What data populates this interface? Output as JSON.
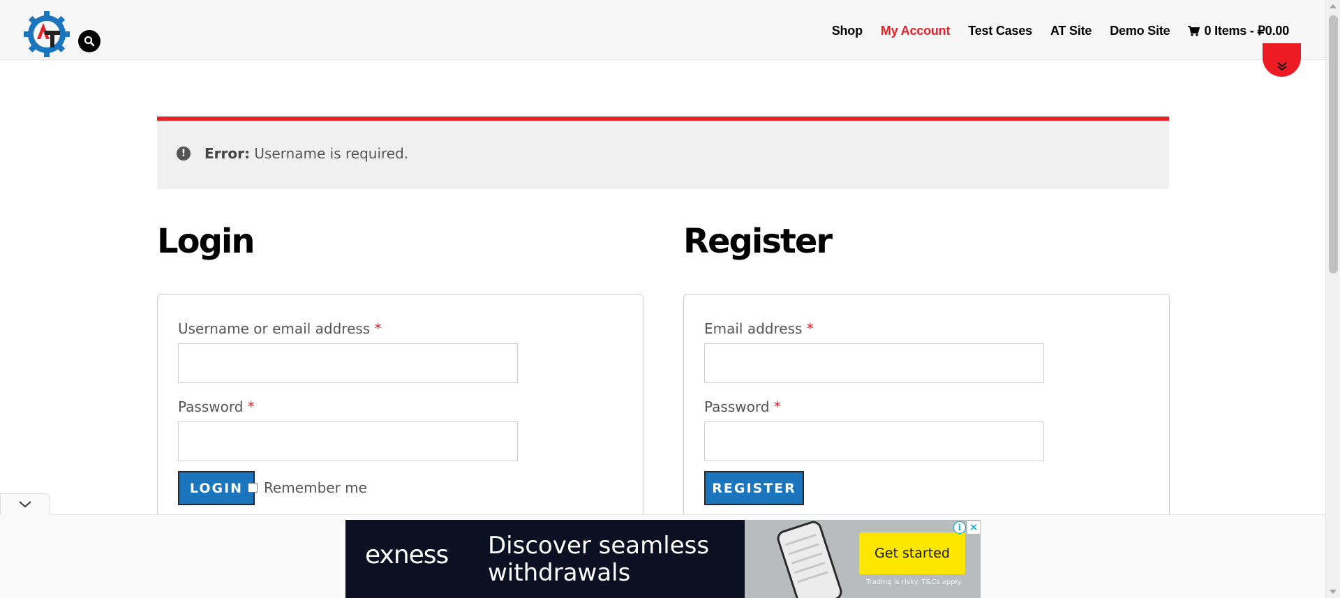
{
  "header": {
    "logo_alt": "AT",
    "nav": [
      {
        "label": "Shop",
        "active": false
      },
      {
        "label": "My Account",
        "active": true
      },
      {
        "label": "Test Cases",
        "active": false
      },
      {
        "label": "AT Site",
        "active": false
      },
      {
        "label": "Demo Site",
        "active": false
      }
    ],
    "cart_label": "0 Items - ₽0.00"
  },
  "notice": {
    "type": "error",
    "prefix": "Error:",
    "message": " Username is required."
  },
  "login": {
    "title": "Login",
    "username_label": "Username or email address",
    "username_value": "",
    "password_label": "Password",
    "password_value": "",
    "button_label": "LOGIN",
    "remember_label": "Remember me",
    "required_marker": "*"
  },
  "register": {
    "title": "Register",
    "email_label": "Email address",
    "email_value": "",
    "password_label": "Password",
    "password_value": "",
    "button_label": "REGISTER",
    "required_marker": "*"
  },
  "ad": {
    "brand": "exness",
    "headline": "Discover seamless withdrawals",
    "cta": "Get started",
    "disclaimer": "Trading is risky. T&Cs apply.",
    "info_glyph": "i",
    "close_glyph": "✕"
  },
  "colors": {
    "accent_red": "#e62129",
    "button_blue": "#1a75bc",
    "ad_background": "#0c1023",
    "ad_cta": "#fce600"
  }
}
